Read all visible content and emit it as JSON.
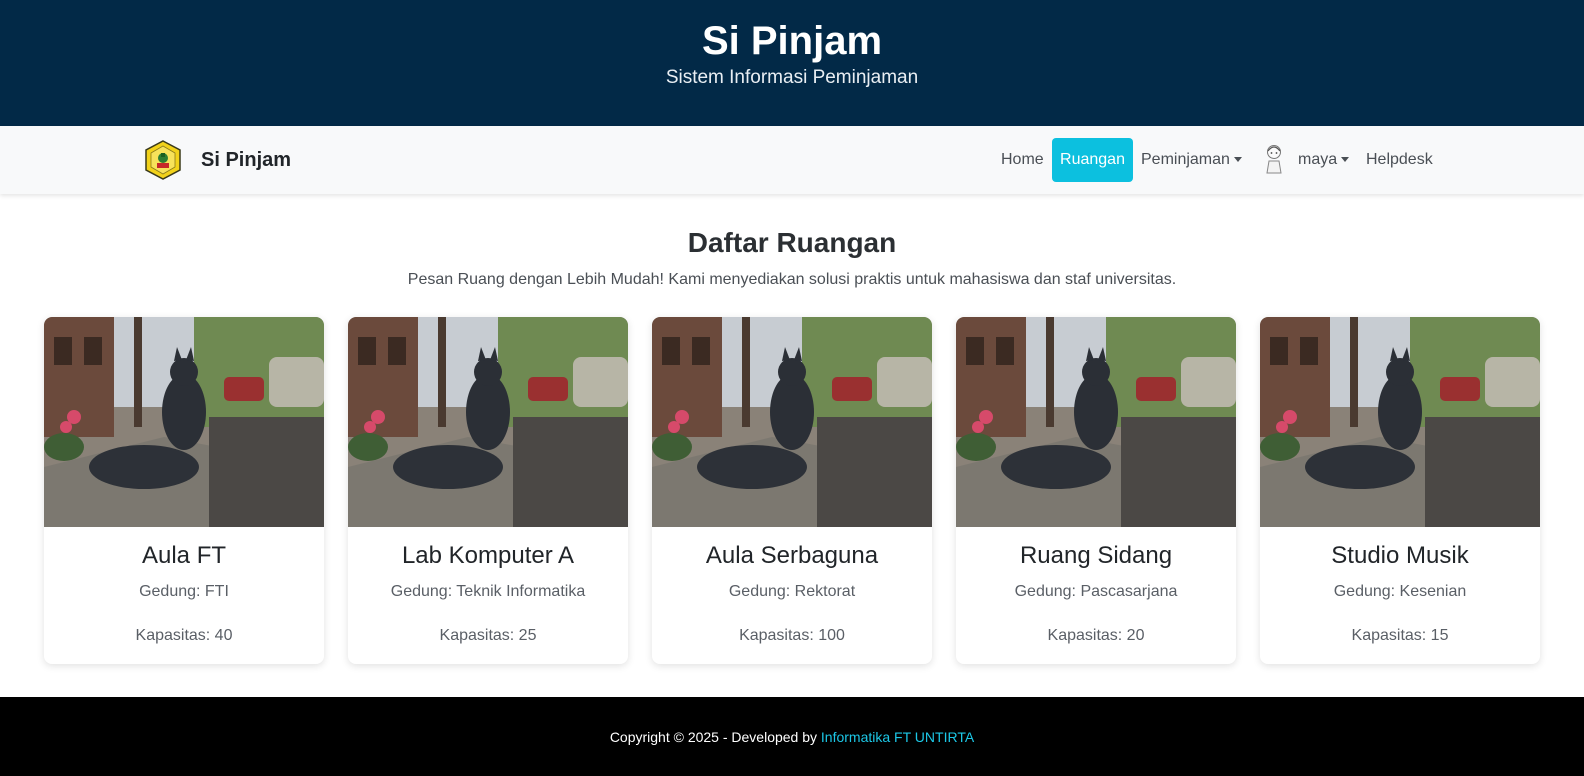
{
  "header": {
    "title": "Si Pinjam",
    "subtitle": "Sistem Informasi Peminjaman"
  },
  "navbar": {
    "brand": "Si Pinjam",
    "links": {
      "home": "Home",
      "ruangan": "Ruangan",
      "peminjaman": "Peminjaman",
      "user": "maya",
      "helpdesk": "Helpdesk"
    }
  },
  "main": {
    "title": "Daftar Ruangan",
    "lead": "Pesan Ruang dengan Lebih Mudah! Kami menyediakan solusi praktis untuk mahasiswa dan staf universitas.",
    "rooms": [
      {
        "name": "Aula FT",
        "building": "Gedung: FTI",
        "capacity": "Kapasitas: 40"
      },
      {
        "name": "Lab Komputer A",
        "building": "Gedung: Teknik Informatika",
        "capacity": "Kapasitas: 25"
      },
      {
        "name": "Aula Serbaguna",
        "building": "Gedung: Rektorat",
        "capacity": "Kapasitas: 100"
      },
      {
        "name": "Ruang Sidang",
        "building": "Gedung: Pascasarjana",
        "capacity": "Kapasitas: 20"
      },
      {
        "name": "Studio Musik",
        "building": "Gedung: Kesenian",
        "capacity": "Kapasitas: 15"
      }
    ]
  },
  "footer": {
    "text": "Copyright © 2025 - Developed by ",
    "link": "Informatika FT UNTIRTA"
  },
  "colors": {
    "header_bg": "#022947",
    "accent": "#0cc0df",
    "footer_bg": "#000000",
    "footer_link": "#1cc7e6"
  }
}
